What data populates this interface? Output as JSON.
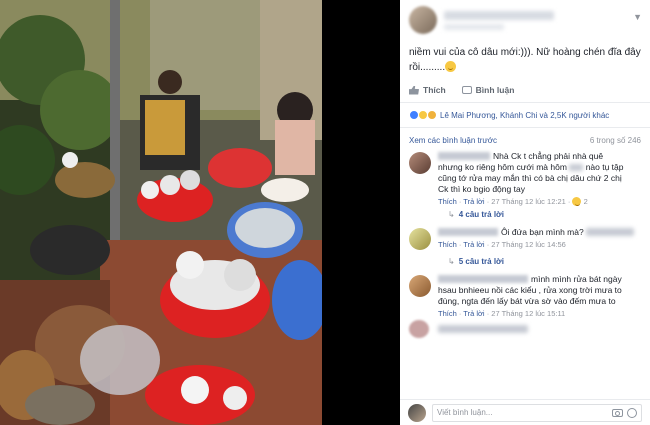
{
  "post": {
    "text_line1": "niềm vui của cô dâu mới:))). Nữ hoàng chén đĩa đây",
    "text_line2": "rồi.........",
    "actions": {
      "like": "Thích",
      "comment": "Bình luận"
    },
    "reactions": "Lê Mai Phương, Khánh Chi và 2,5K người khác"
  },
  "comments_header": {
    "more": "Xem các bình luận trước",
    "count": "6 trong số 246"
  },
  "comments": [
    {
      "line1": "Nhà Ck t chẳng phải nhà quê",
      "line2": "nhưng ko riêng hôm cưới mà hôm",
      "line2b": "nào tụ tập",
      "line3": "cũng tớ rửa may mắn thì có bà chị dâu chứ 2 chị",
      "line4": "Ck thì ko bgio động tay",
      "like": "Thích",
      "reply": "Trả lời",
      "time": "27 Tháng 12 lúc 12:21",
      "reactions_count": "2",
      "replies": "4 câu trả lời"
    },
    {
      "line1": "Ôi đứa bạn mình mà?",
      "like": "Thích",
      "reply": "Trả lời",
      "time": "27 Tháng 12 lúc 14:56",
      "replies": "5 câu trả lời"
    },
    {
      "line1": "mình mình rửa bát ngày",
      "line2": "hsau bnhieeu nồi các kiểu , rửa xong trời mưa to",
      "line3": "đùng, ngta đến lấy bát vừa sờ vào đếm mưa to",
      "like": "Thích",
      "reply": "Trả lời",
      "time": "27 Tháng 12 lúc 15:11"
    }
  ],
  "input": {
    "placeholder": "Viết bình luận..."
  },
  "icons": [
    "chevron-down-icon",
    "like-icon",
    "comment-icon",
    "camera-icon",
    "emoji-icon"
  ],
  "colors": {
    "link": "#365899",
    "meta": "#90949c",
    "like_reaction": "#4080ff"
  }
}
